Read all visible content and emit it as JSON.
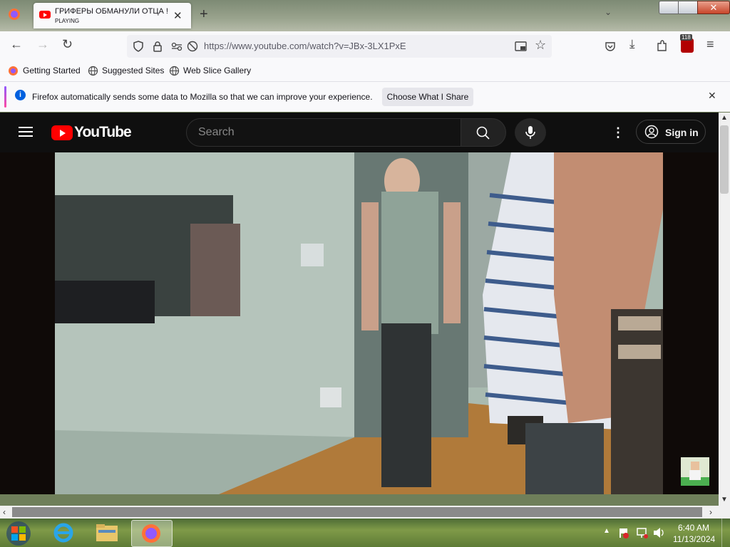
{
  "browser": {
    "tab": {
      "title": "ГРИФЕРЫ ОБМАНУЛИ ОТЦА !",
      "status": "PLAYING"
    },
    "url": "https://www.youtube.com/watch?v=JBx-3LX1PxE",
    "badge_count": "118",
    "bookmarks": [
      "Getting Started",
      "Suggested Sites",
      "Web Slice Gallery"
    ],
    "notification": {
      "text": "Firefox automatically sends some data to Mozilla so that we can improve your experience.",
      "button": "Choose What I Share"
    }
  },
  "youtube": {
    "logo_text": "YouTube",
    "search_placeholder": "Search",
    "signin_label": "Sign in"
  },
  "taskbar": {
    "time": "6:40 AM",
    "date": "11/13/2024"
  },
  "colors": {
    "yt_red": "#ff0000",
    "yt_bg": "#0f0f0f",
    "firefox_blue": "#0060df"
  }
}
